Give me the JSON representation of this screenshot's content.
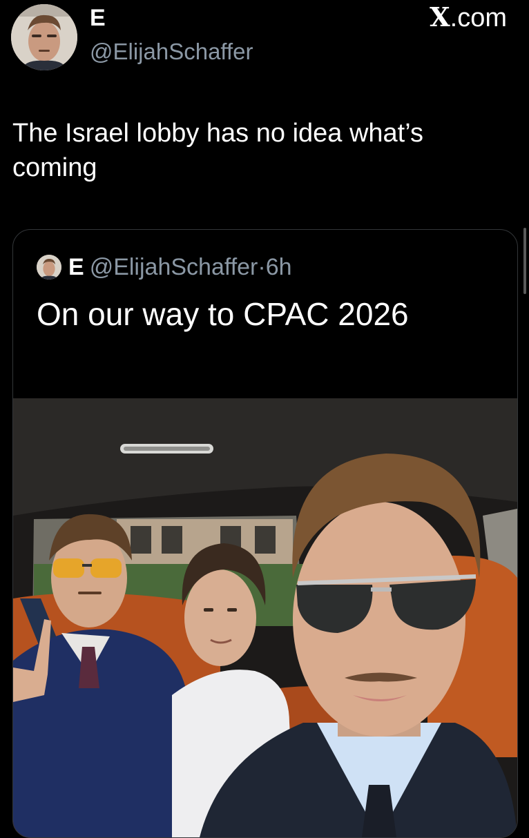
{
  "header": {
    "display_name": "E",
    "handle": "@ElijahSchaffer",
    "brand_x": "X",
    "brand_suffix": ".com"
  },
  "tweet": {
    "text": "The Israel lobby has no idea what’s coming"
  },
  "quoted": {
    "display_name": "E",
    "handle": "@ElijahSchaffer",
    "separator": "·",
    "time": "6h",
    "text": "On our way to CPAC 2026"
  },
  "icons": {
    "avatar": "profile-photo",
    "quote_avatar": "profile-photo-small",
    "photo": "selfie-photo-in-car"
  },
  "colors": {
    "background": "#000000",
    "text": "#ffffff",
    "secondary_text": "#8b98a5",
    "border": "#333639"
  }
}
